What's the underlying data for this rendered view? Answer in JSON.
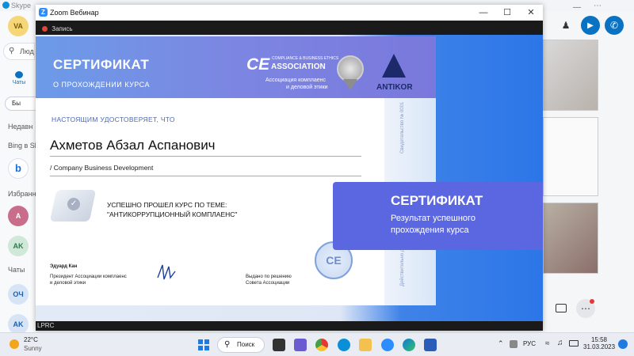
{
  "skype": {
    "title": "Skype",
    "user_initials": "VA",
    "search_placeholder": "Люд",
    "chats_label": "Чаты",
    "bots_chip": "Бы",
    "recent_label": "Недавн",
    "bing_label": "Bing в Sk",
    "favorites_label": "Избранн",
    "chats_section": "Чаты",
    "contacts": [
      {
        "initials": "А",
        "color": "#c96e8a"
      },
      {
        "initials": "AK",
        "color": "#cfe8d8"
      },
      {
        "initials": "ОЧ",
        "color": "#d6e4f5"
      },
      {
        "initials": "AK",
        "color": "#d6e4f5"
      }
    ]
  },
  "zoom": {
    "title": "Zoom Вебинар",
    "recording_label": "Запись",
    "participant_name": "LPRC"
  },
  "certificate": {
    "heading": "СЕРТИФИКАТ",
    "subheading": "О ПРОХОЖДЕНИИ КУРСА",
    "ce_logo": "CE",
    "association_logo": "ASSOCIATION",
    "association_tagline": "COMPLIANCE & BUSINESS ETHICS",
    "association_desc_1": "Ассоциация комплаенс",
    "association_desc_2": "и деловой этики",
    "antikor_logo": "ANTIKOR",
    "certifies_label": "НАСТОЯЩИМ УДОСТОВЕРЯЕТ, ЧТО",
    "recipient_name": "Ахметов Абзал Аспанович",
    "recipient_role": "/ Company Business Development",
    "course_intro": "УСПЕШНО ПРОШЕЛ КУРС ПО ТЕМЕ:",
    "course_title": "\"АНТИКОРРУПЦИОННЫЙ КОМПЛАЕНС\"",
    "signatory_name": "Эдуард Кан",
    "signatory_title_1": "Президент Ассоциации комплаенс",
    "signatory_title_2": "и деловой этики",
    "issued_label_1": "Выдано по решению",
    "issued_label_2": "Совета Ассоциации",
    "seal_text": "CE",
    "vertical_number": "Свидетельство № 0001",
    "vertical_note": "Действительно до"
  },
  "overlay": {
    "title": "СЕРТИФИКАТ",
    "line1": "Результат успешного",
    "line2": "прохождения курса"
  },
  "taskbar": {
    "weather_temp": "22°C",
    "weather_desc": "Sunny",
    "search_label": "Поиск",
    "language": "РУС",
    "time": "15:58",
    "date": "31.03.2023"
  }
}
